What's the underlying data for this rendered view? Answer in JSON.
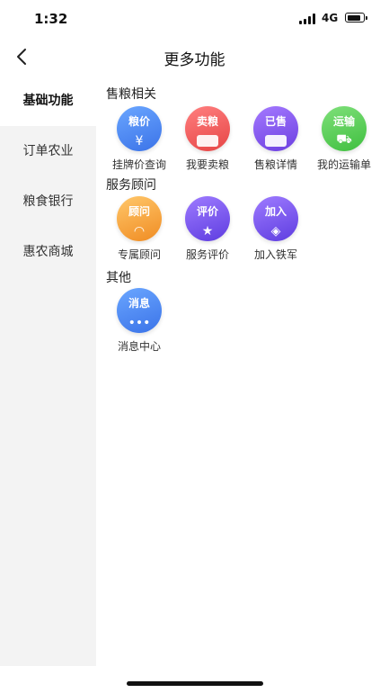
{
  "status": {
    "time": "1:32",
    "network": "4G"
  },
  "header": {
    "title": "更多功能"
  },
  "sidebar": {
    "items": [
      {
        "label": "基础功能",
        "active": true
      },
      {
        "label": "订单农业"
      },
      {
        "label": "粮食银行"
      },
      {
        "label": "惠农商城"
      }
    ]
  },
  "sections": [
    {
      "title": "售粮相关",
      "tiles": [
        {
          "badge": "粮价",
          "label": "挂牌价查询",
          "icon": "price-icon",
          "color": "#3b73e8"
        },
        {
          "badge": "卖粮",
          "label": "我要卖粮",
          "icon": "sell-grain-icon",
          "color": "#e64545"
        },
        {
          "badge": "已售",
          "label": "售粮详情",
          "icon": "sold-details-icon",
          "color": "#6b3fe0"
        },
        {
          "badge": "运输",
          "label": "我的运输单",
          "icon": "truck-icon",
          "color": "#3fbf3f"
        }
      ]
    },
    {
      "title": "服务顾问",
      "tiles": [
        {
          "badge": "顾问",
          "label": "专属顾问",
          "icon": "advisor-icon",
          "color": "#f08c23"
        },
        {
          "badge": "评价",
          "label": "服务评价",
          "icon": "star-icon",
          "color": "#5e3de0"
        },
        {
          "badge": "加入",
          "label": "加入铁军",
          "icon": "layers-icon",
          "color": "#5e3de0"
        }
      ]
    },
    {
      "title": "其他",
      "tiles": [
        {
          "badge": "消息",
          "label": "消息中心",
          "icon": "message-icon",
          "color": "#3b73e8"
        }
      ]
    }
  ]
}
